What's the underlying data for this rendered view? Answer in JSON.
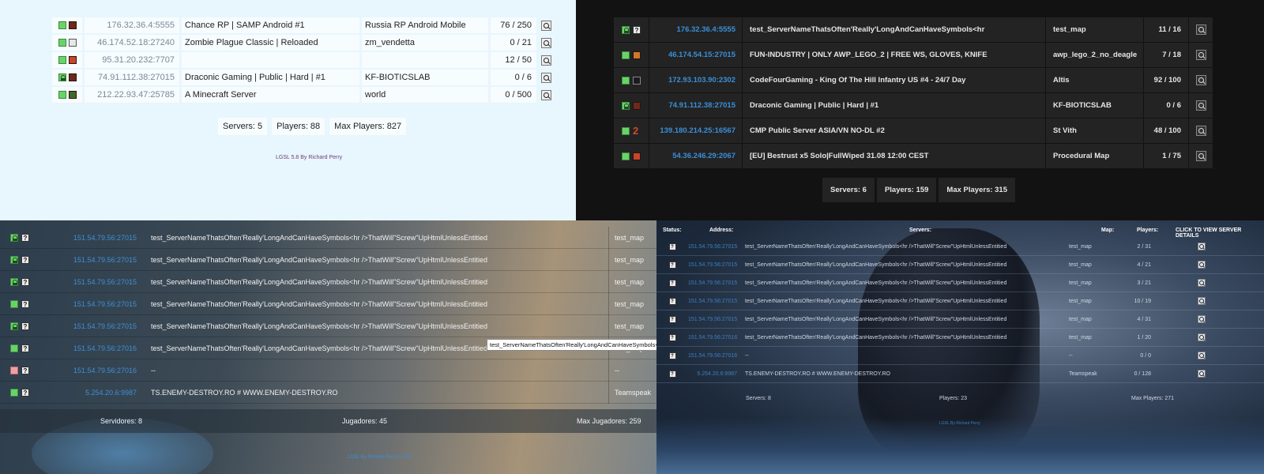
{
  "q1": {
    "rows": [
      {
        "status": "online",
        "game": "samp",
        "address": "176.32.36.4:5555",
        "name": "Chance RP | SAMP Android #1",
        "map": "Russia RP Android Mobile",
        "players": "76 / 250"
      },
      {
        "status": "online",
        "game": "cs",
        "address": "46.174.52.18:27240",
        "name": "Zombie Plague Classic | Reloaded",
        "map": "zm_vendetta",
        "players": "0 / 21"
      },
      {
        "status": "online",
        "game": "rust",
        "address": "95.31.20.232:7707",
        "name": "",
        "map": "",
        "players": "12 / 50"
      },
      {
        "status": "password",
        "game": "kf",
        "address": "74.91.112.38:27015",
        "name": "Draconic Gaming | Public | Hard | #1",
        "map": "KF-BIOTICSLAB",
        "players": "0 / 6"
      },
      {
        "status": "online",
        "game": "mc",
        "address": "212.22.93.47:25785",
        "name": "A Minecraft Server",
        "map": "world",
        "players": "0 / 500"
      }
    ],
    "totals": {
      "servers": "Servers: 5",
      "players": "Players: 88",
      "max_players": "Max Players: 827"
    },
    "footer": "LGSL 5.8 By Richard Perry"
  },
  "q2": {
    "rows": [
      {
        "status": "password",
        "game": "unknown",
        "address": "176.32.36.4:5555",
        "name": "test_ServerNameThatsOften'Really'LongAndCanHaveSymbols<hr",
        "map": "test_map",
        "players": "11 / 16"
      },
      {
        "status": "online",
        "game": "cs",
        "address": "46.174.54.15:27015",
        "name": "FUN-INDUSTRY | ONLY AWP_LEGO_2 | FREE WS, GLOVES, KNIFE",
        "map": "awp_lego_2_no_deagle",
        "players": "7 / 18"
      },
      {
        "status": "online",
        "game": "arma",
        "address": "172.93.103.90:2302",
        "name": "CodeFourGaming - King Of The Hill Infantry US #4 - 24/7 Day",
        "map": "Altis",
        "players": "92 / 100"
      },
      {
        "status": "password",
        "game": "kf",
        "address": "74.91.112.38:27015",
        "name": "Draconic Gaming | Public | Hard | #1",
        "map": "KF-BIOTICSLAB",
        "players": "0 / 6"
      },
      {
        "status": "online",
        "game": "cod2",
        "address": "139.180.214.25:16567",
        "name": "CMP Public Server ASIA/VN NO-DL #2",
        "map": "St Vith",
        "players": "48 / 100"
      },
      {
        "status": "online",
        "game": "rust",
        "address": "54.36.246.29:2067",
        "name": "[EU] Bestrust x5 Solo|FullWiped 31.08 12:00 CEST",
        "map": "Procedural Map",
        "players": "1 / 75"
      }
    ],
    "totals": {
      "servers": "Servers: 6",
      "players": "Players: 159",
      "max_players": "Max Players: 315"
    }
  },
  "q3": {
    "rows": [
      {
        "status": "password",
        "address": "151.54.79.56:27015",
        "name": "test_ServerNameThatsOften'Really'LongAndCanHaveSymbols<hr />ThatWill\"Screw\"UpHtmlUnlessEntitied",
        "map": "test_map"
      },
      {
        "status": "password",
        "address": "151.54.79.56:27015",
        "name": "test_ServerNameThatsOften'Really'LongAndCanHaveSymbols<hr />ThatWill\"Screw\"UpHtmlUnlessEntitied",
        "map": "test_map"
      },
      {
        "status": "password",
        "address": "151.54.79.56:27015",
        "name": "test_ServerNameThatsOften'Really'LongAndCanHaveSymbols<hr />ThatWill\"Screw\"UpHtmlUnlessEntitied",
        "map": "test_map"
      },
      {
        "status": "online",
        "address": "151.54.79.56:27015",
        "name": "test_ServerNameThatsOften'Really'LongAndCanHaveSymbols<hr />ThatWill\"Screw\"UpHtmlUnlessEntitied",
        "map": "test_map"
      },
      {
        "status": "password",
        "address": "151.54.79.56:27015",
        "name": "test_ServerNameThatsOften'Really'LongAndCanHaveSymbols<hr />ThatWill\"Screw\"UpHtmlUnlessEntitied",
        "map": "test_map"
      },
      {
        "status": "online",
        "address": "151.54.79.56:27016",
        "name": "test_ServerNameThatsOften'Really'LongAndCanHaveSymbols<hr />ThatWill\"Screw\"UpHtmlUnlessEntitied",
        "map": "test_map"
      },
      {
        "status": "offline",
        "address": "151.54.79.56:27016",
        "name": "--",
        "map": "--"
      },
      {
        "status": "online",
        "address": "5.254.20.6:9987",
        "name": "TS.ENEMY-DESTROY.RO # WWW.ENEMY-DESTROY.RO",
        "map": "Teamspeak"
      }
    ],
    "tooltip": "test_ServerNameThatsOften'Really'LongAndCanHaveSymbols<hr",
    "totals": {
      "servers": "Servidores: 8",
      "players": "Jugadores: 45",
      "max_players": "Max Jugadores: 259"
    },
    "footer": "LGSL By Richard Perry | LGSL"
  },
  "q4": {
    "headers": {
      "status": "Status:",
      "address": "Address:",
      "servers": "Servers:",
      "map": "Map:",
      "players": "Players:",
      "details": "CLICK TO VIEW SERVER DETAILS"
    },
    "rows": [
      {
        "address": "151.54.79.56:27015",
        "name": "test_ServerNameThatsOften'Really'LongAndCanHaveSymbols<hr />ThatWill\"Screw\"UpHtmlUnlessEntitied",
        "map": "test_map",
        "players": "2 / 31"
      },
      {
        "address": "151.54.79.56:27015",
        "name": "test_ServerNameThatsOften'Really'LongAndCanHaveSymbols<hr />ThatWill\"Screw\"UpHtmlUnlessEntitied",
        "map": "test_map",
        "players": "4 / 21"
      },
      {
        "address": "151.54.79.56:27015",
        "name": "test_ServerNameThatsOften'Really'LongAndCanHaveSymbols<hr />ThatWill\"Screw\"UpHtmlUnlessEntitied",
        "map": "test_map",
        "players": "3 / 21"
      },
      {
        "address": "151.54.79.56:27015",
        "name": "test_ServerNameThatsOften'Really'LongAndCanHaveSymbols<hr />ThatWill\"Screw\"UpHtmlUnlessEntitied",
        "map": "test_map",
        "players": "10 / 19"
      },
      {
        "address": "151.54.79.56:27015",
        "name": "test_ServerNameThatsOften'Really'LongAndCanHaveSymbols<hr />ThatWill\"Screw\"UpHtmlUnlessEntitied",
        "map": "test_map",
        "players": "4 / 31"
      },
      {
        "address": "151.54.79.56:27016",
        "name": "test_ServerNameThatsOften'Really'LongAndCanHaveSymbols<hr />ThatWill\"Screw\"UpHtmlUnlessEntitied",
        "map": "test_map",
        "players": "1 / 20"
      },
      {
        "address": "151.54.79.56:27016",
        "name": "--",
        "map": "--",
        "players": "0 / 0"
      },
      {
        "address": "5.254.20.6:9987",
        "name": "TS.ENEMY-DESTROY.RO # WWW.ENEMY-DESTROY.RO",
        "map": "Teamspeak",
        "players": "0 / 128"
      }
    ],
    "totals": {
      "servers": "Servers: 8",
      "players": "Players: 23",
      "max_players": "Max Players: 271"
    },
    "footer": "LGSL By Richard Perry"
  },
  "colors": {
    "online": "#69d36a",
    "offline": "#f0a0a5",
    "address_blue": "#3a8fd8",
    "footer_purple": "#6b3f7a"
  },
  "icons": {
    "status_online": "green-square-icon",
    "status_password": "lock-icon",
    "status_offline": "red-square-icon",
    "unknown_game": "question-icon",
    "details": "magnifier-icon"
  }
}
